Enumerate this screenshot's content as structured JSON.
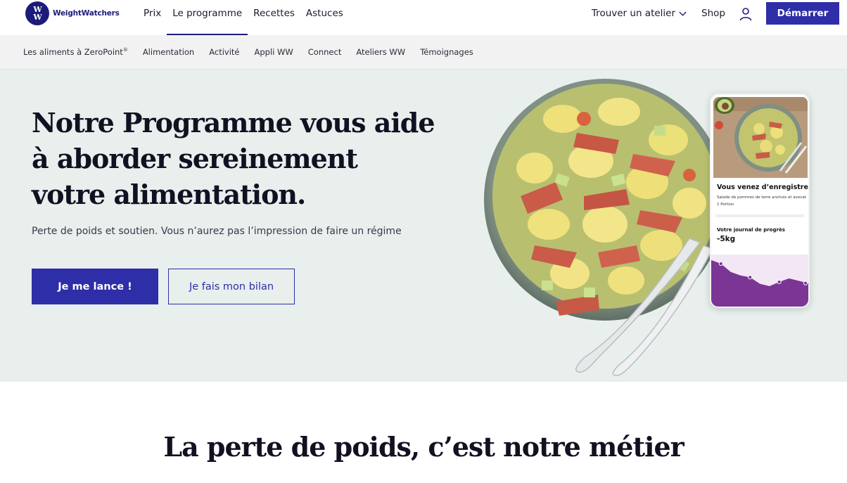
{
  "brand": {
    "logo_letters_top": "W",
    "logo_letters_bottom": "W",
    "name": "WeightWatchers"
  },
  "nav": {
    "primary": [
      {
        "label": "Prix",
        "active": false
      },
      {
        "label": "Le programme",
        "active": true
      },
      {
        "label": "Recettes",
        "active": false
      },
      {
        "label": "Astuces",
        "active": false
      }
    ],
    "find_workshop": "Trouver un atelier",
    "shop": "Shop",
    "start_button": "Démarrer"
  },
  "subnav": [
    {
      "label": "Les aliments à ZeroPoint",
      "sup": "®"
    },
    {
      "label": "Alimentation"
    },
    {
      "label": "Activité"
    },
    {
      "label": "Appli WW"
    },
    {
      "label": "Connect"
    },
    {
      "label": "Ateliers WW"
    },
    {
      "label": "Témoignages"
    }
  ],
  "hero": {
    "title_lines": [
      "Notre Programme vous aide",
      "à aborder sereinement",
      "votre alimentation."
    ],
    "subtitle": "Perte de poids et soutien. Vous n’aurez pas l’impression de faire un régime",
    "cta_primary": "Je me lance !",
    "cta_secondary": "Je fais mon bilan"
  },
  "phone_card": {
    "title": "Vous venez d’enregistrer",
    "meal": "Salade de pommes de terre anchois et avocat",
    "portion": "1 Portion",
    "journal_label": "Votre journal de progrès",
    "journal_value": "-5kg",
    "progress_points": [
      100,
      88,
      60,
      48,
      42,
      20,
      12,
      26,
      38,
      30,
      22
    ]
  },
  "section": {
    "title": "La perte de poids, c’est notre métier"
  },
  "colors": {
    "brand": "#1c1b7a",
    "button": "#2e2ea8",
    "hero_bg": "#e8efed",
    "chart_fill": "#7b3594",
    "chart_bg": "#f3e6f5"
  }
}
